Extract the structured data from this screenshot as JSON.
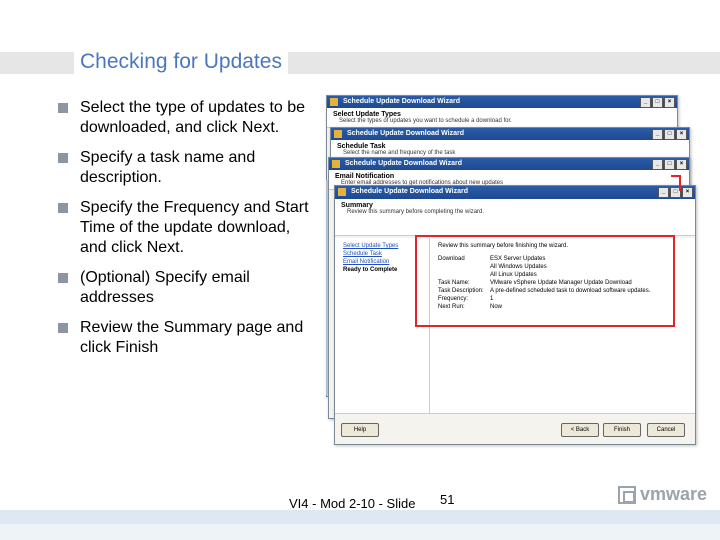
{
  "slide": {
    "title": "Checking for Updates",
    "bullets": [
      "Select the type of updates to be downloaded, and click Next.",
      "Specify a task name and description.",
      "Specify the Frequency and Start Time of the update download, and click Next.",
      "(Optional) Specify email addresses",
      "Review the Summary page and click Finish"
    ],
    "footer": "VI4 - Mod 2-10 - Slide",
    "slide_number": "51",
    "logo": "vmware",
    "accent_color": "#4b77be",
    "highlight_color": "#e0252b"
  },
  "windows": {
    "w1": {
      "title": "Schedule Update Download Wizard",
      "heading": "Select Update Types",
      "subheading": "Select the types of updates you want to schedule a download for."
    },
    "w2": {
      "title": "Schedule Update Download Wizard",
      "heading": "Schedule Task",
      "subheading": "Select the name and frequency of the task"
    },
    "w3": {
      "title": "Schedule Update Download Wizard",
      "heading": "Email Notification",
      "subheading": "Enter email addresses to get notifications about new updates"
    },
    "w4": {
      "title": "Schedule Update Download Wizard",
      "heading": "Summary",
      "subheading": "Review this summary before completing the wizard.",
      "nav": [
        "Select Update Types",
        "Schedule Task",
        "Email Notification",
        "Ready to Complete"
      ],
      "intro": "Review this summary before finishing the wizard.",
      "summary_rows": [
        {
          "key": "Download",
          "value": "ESX Server Updates"
        },
        {
          "key": "",
          "value": "All Windows Updates"
        },
        {
          "key": "",
          "value": "All Linux Updates"
        },
        {
          "key": "Task Name:",
          "value": "VMware vSphere Update Manager Update Download"
        },
        {
          "key": "Task Description:",
          "value": "A pre-defined scheduled task to download software updates."
        },
        {
          "key": "Frequency:",
          "value": "1"
        },
        {
          "key": "Next Run:",
          "value": "Now"
        }
      ],
      "buttons": {
        "help": "Help",
        "back": "< Back",
        "finish": "Finish",
        "cancel": "Cancel"
      }
    }
  }
}
